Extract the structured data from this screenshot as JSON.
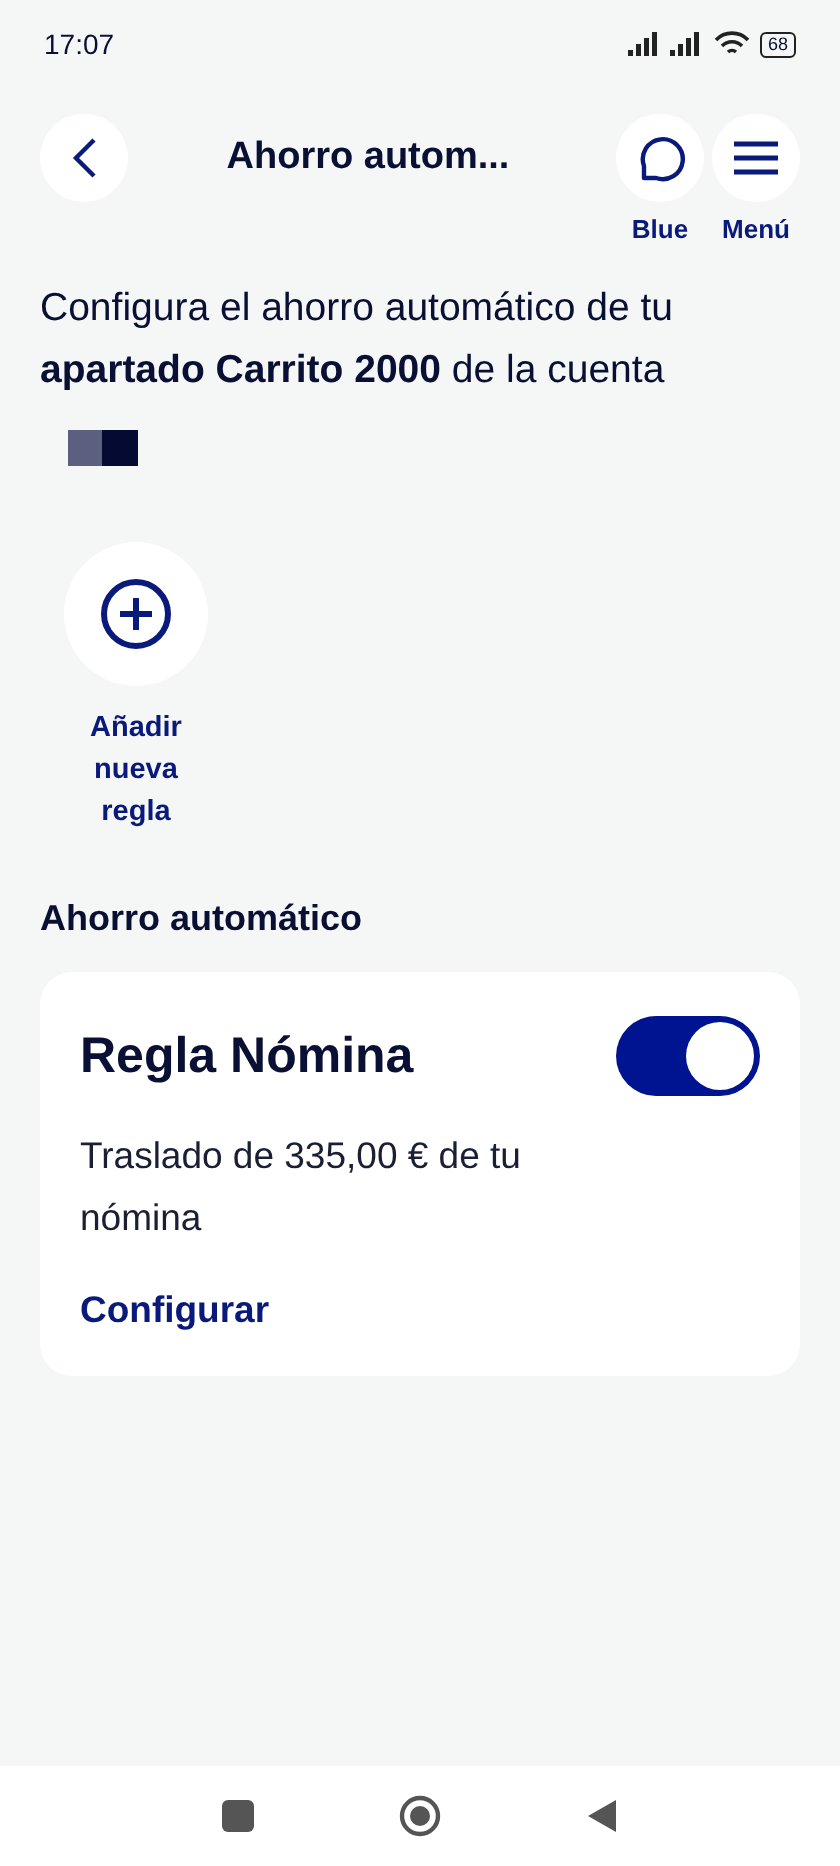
{
  "status_bar": {
    "time": "17:07",
    "battery": "68"
  },
  "header": {
    "title": "Ahorro autom...",
    "actions": [
      {
        "kind": "chat",
        "label": "Blue"
      },
      {
        "kind": "menu",
        "label": "Menú"
      }
    ]
  },
  "intro": "Configura el ahorro automático de tu **apartado Carrito 2000** de la cuenta",
  "add_rule": {
    "label": "Añadir nueva regla"
  },
  "section_title": "Ahorro automático",
  "rules": [
    {
      "title": "Regla Nómina",
      "on": true,
      "description": "Traslado de 335,00 € de tu nómina",
      "link": "Configurar"
    }
  ]
}
